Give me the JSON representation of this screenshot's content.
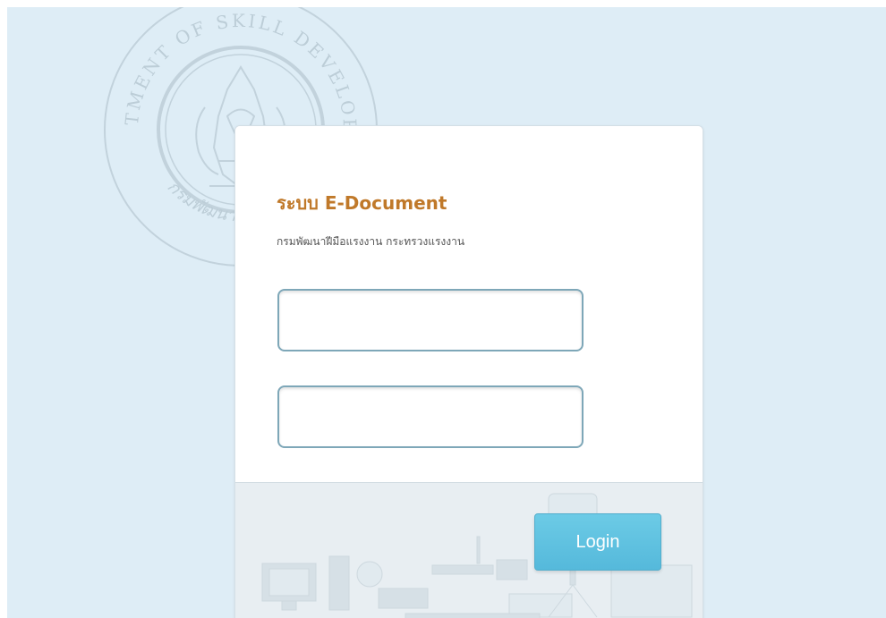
{
  "background": {
    "color": "#deedf6",
    "seal_icon": "department-seal",
    "seal_text_top": "DEPARTMENT OF SKILL DEVELOPMENT",
    "seal_text_bottom": "กรมพัฒนาฝีมือแรงงาน"
  },
  "login": {
    "title": "ระบบ E-Document",
    "subtitle": "กรมพัฒนาฝีมือแรงงาน กระทรวงแรงงาน",
    "username": {
      "value": "",
      "placeholder": ""
    },
    "password": {
      "value": "",
      "placeholder": ""
    },
    "button_label": "Login"
  },
  "colors": {
    "title": "#c0792a",
    "button": "#5bc0de",
    "field_border": "#7ea7b8"
  },
  "footer": {
    "illustration_icon": "office-equipment-illustration"
  }
}
